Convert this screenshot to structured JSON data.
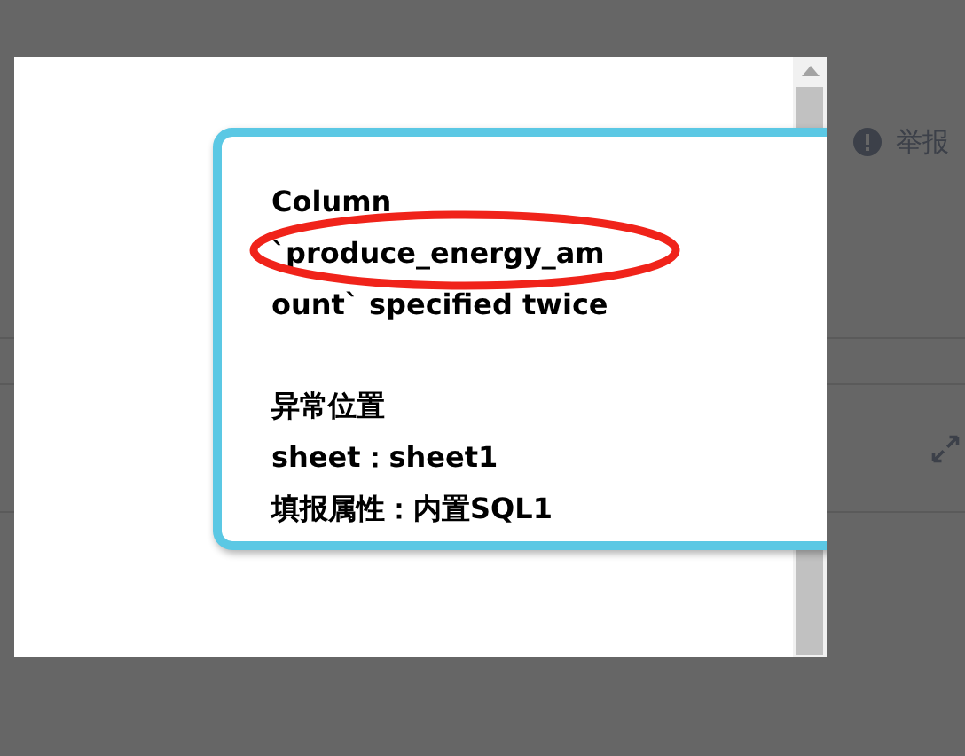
{
  "page": {
    "report_link": "举报"
  },
  "dialog": {
    "message_lines": [
      "Column",
      "`produce_energy_am",
      "ount` specified twice"
    ],
    "detail_lines": [
      "异常位置",
      "sheet：sheet1",
      "填报属性：内置SQL1"
    ]
  }
}
